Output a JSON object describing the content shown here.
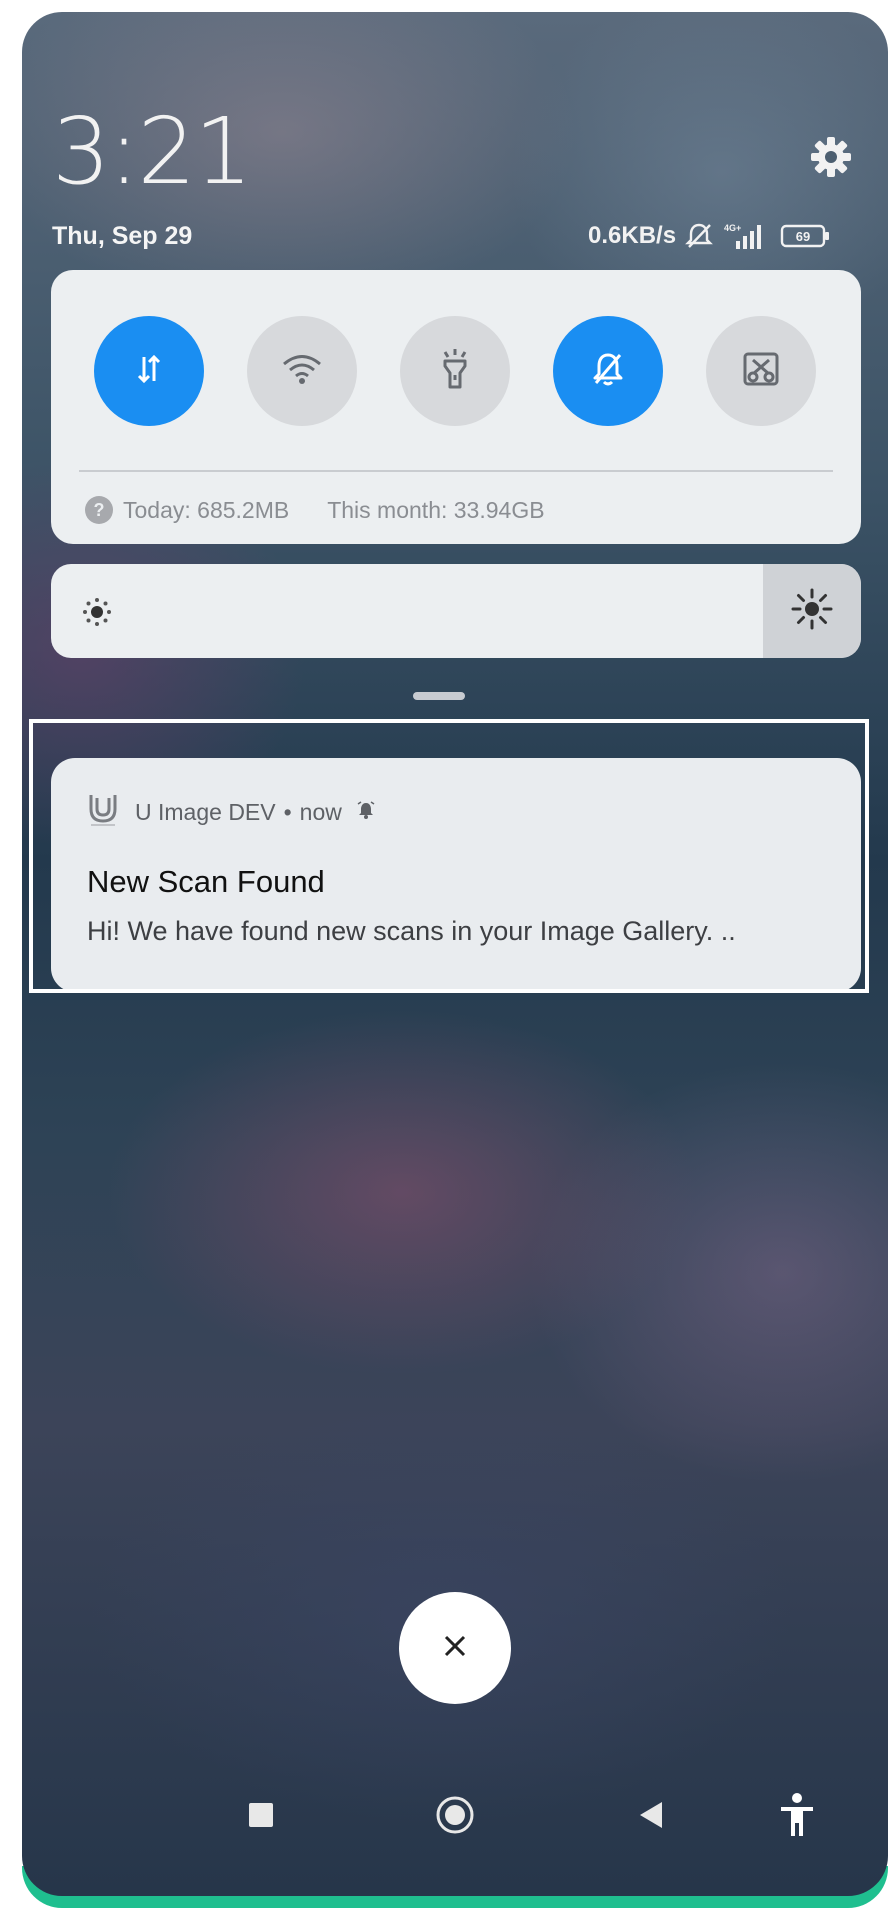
{
  "status": {
    "time": "3:21",
    "date": "Thu, Sep 29",
    "network_speed": "0.6KB/s",
    "network_type": "4G+",
    "battery": "69",
    "icons": [
      "silent-icon",
      "signal-icon",
      "battery-icon",
      "settings-gear-icon"
    ]
  },
  "quick_settings": {
    "toggles": [
      {
        "name": "mobile-data",
        "icon": "data-arrows-icon",
        "state": "on"
      },
      {
        "name": "wifi",
        "icon": "wifi-icon",
        "state": "off"
      },
      {
        "name": "flashlight",
        "icon": "flashlight-icon",
        "state": "off"
      },
      {
        "name": "silent",
        "icon": "bell-off-icon",
        "state": "on"
      },
      {
        "name": "screenshot",
        "icon": "screenshot-scissors-icon",
        "state": "off"
      }
    ],
    "usage_today": "Today: 685.2MB",
    "usage_month": "This month: 33.94GB",
    "active_color": "#1a8ef2"
  },
  "brightness": {
    "level": 0.12
  },
  "notification": {
    "app_name": "U Image DEV",
    "separator": "•",
    "time": "now",
    "title": "New Scan Found",
    "body": "Hi! We have found new scans in your Image Gallery. .."
  },
  "close_label": "×",
  "navbar": [
    "recents-square-icon",
    "home-circle-icon",
    "back-triangle-icon",
    "accessibility-icon"
  ],
  "accent_bottom": "#1fbf8f"
}
